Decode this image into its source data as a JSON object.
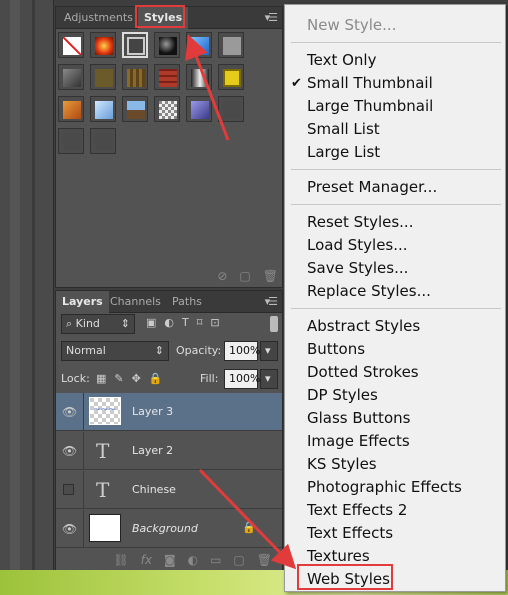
{
  "styles_panel": {
    "tabs": [
      "Adjustments",
      "Styles"
    ],
    "active_tab": "Styles",
    "menu_icon": "panel-menu-icon"
  },
  "layers_panel": {
    "tabs": [
      "Layers",
      "Channels",
      "Paths"
    ],
    "filter": "Kind",
    "blend_mode": "Normal",
    "opacity_label": "Opacity:",
    "opacity_value": "100%",
    "lock_label": "Lock:",
    "fill_label": "Fill:",
    "fill_value": "100%",
    "layers": [
      {
        "name": "Layer 3",
        "selected": true,
        "visible": true,
        "kind": "image"
      },
      {
        "name": "Layer 2",
        "selected": false,
        "visible": true,
        "kind": "text"
      },
      {
        "name": "Chinese",
        "selected": false,
        "visible": false,
        "kind": "text"
      },
      {
        "name": "Background",
        "selected": false,
        "visible": true,
        "kind": "background",
        "locked": true
      }
    ]
  },
  "styles_menu": {
    "items": [
      {
        "label": "New Style...",
        "disabled": true
      },
      {
        "label": "Text Only"
      },
      {
        "label": "Small Thumbnail",
        "checked": true
      },
      {
        "label": "Large Thumbnail"
      },
      {
        "label": "Small List"
      },
      {
        "label": "Large List"
      },
      {
        "label": "Preset Manager..."
      },
      {
        "label": "Reset Styles..."
      },
      {
        "label": "Load Styles..."
      },
      {
        "label": "Save Styles..."
      },
      {
        "label": "Replace Styles..."
      },
      {
        "label": "Abstract Styles"
      },
      {
        "label": "Buttons"
      },
      {
        "label": "Dotted Strokes"
      },
      {
        "label": "DP Styles"
      },
      {
        "label": "Glass Buttons"
      },
      {
        "label": "Image Effects"
      },
      {
        "label": "KS Styles"
      },
      {
        "label": "Photographic Effects"
      },
      {
        "label": "Text Effects 2"
      },
      {
        "label": "Text Effects"
      },
      {
        "label": "Textures"
      },
      {
        "label": "Web Styles",
        "highlighted": true
      }
    ]
  },
  "colors": {
    "annotation": "#e23b3b",
    "panel": "#535353",
    "selection": "#5b7089"
  }
}
